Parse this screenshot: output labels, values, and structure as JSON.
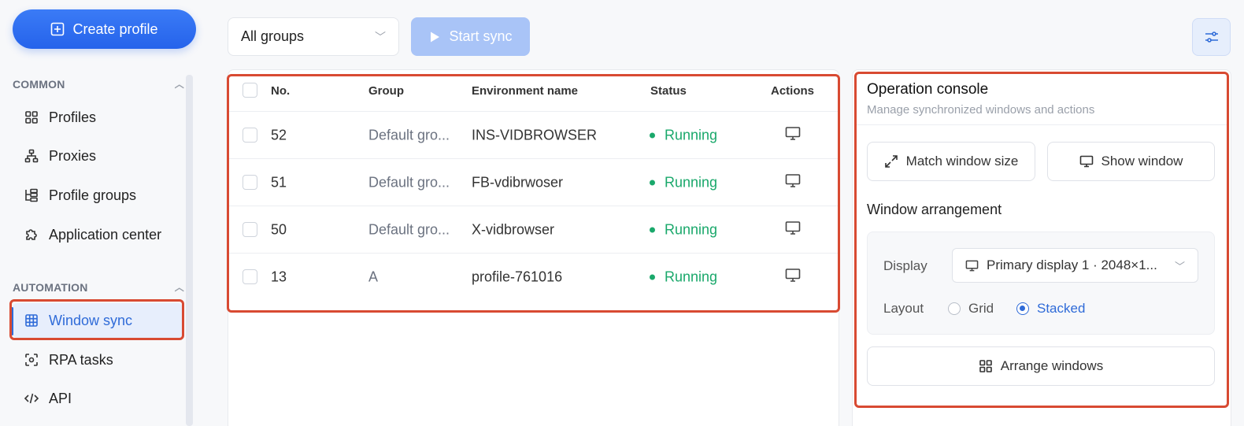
{
  "sidebar": {
    "create_label": "Create profile",
    "common_label": "COMMON",
    "automation_label": "AUTOMATION",
    "common_items": [
      {
        "label": "Profiles",
        "icon": "grid-icon"
      },
      {
        "label": "Proxies",
        "icon": "network-icon"
      },
      {
        "label": "Profile groups",
        "icon": "tree-icon"
      },
      {
        "label": "Application center",
        "icon": "puzzle-icon"
      }
    ],
    "automation_items": [
      {
        "label": "Window sync",
        "icon": "table-grid-icon",
        "active": true
      },
      {
        "label": "RPA tasks",
        "icon": "scan-icon"
      },
      {
        "label": "API",
        "icon": "code-icon"
      }
    ]
  },
  "toolbar": {
    "group_select": "All groups",
    "start_sync_label": "Start sync"
  },
  "table": {
    "headers": {
      "no": "No.",
      "group": "Group",
      "env": "Environment name",
      "status": "Status",
      "actions": "Actions"
    },
    "rows": [
      {
        "no": "52",
        "group": "Default gro...",
        "env": "INS-VIDBROWSER",
        "status": "Running"
      },
      {
        "no": "51",
        "group": "Default gro...",
        "env": "FB-vdibrwoser",
        "status": "Running"
      },
      {
        "no": "50",
        "group": "Default gro...",
        "env": "X-vidbrowser",
        "status": "Running"
      },
      {
        "no": "13",
        "group": "A",
        "env": "profile-761016",
        "status": "Running"
      }
    ]
  },
  "console": {
    "title": "Operation console",
    "subtitle": "Manage synchronized windows and actions",
    "match_label": "Match window size",
    "show_label": "Show window",
    "arrangement_title": "Window arrangement",
    "display_label": "Display",
    "display_value": "Primary display 1 · 2048×1...",
    "layout_label": "Layout",
    "layout_options": [
      "Grid",
      "Stacked"
    ],
    "layout_selected": "Stacked",
    "arrange_label": "Arrange windows"
  },
  "colors": {
    "accent": "#2f6bd8",
    "running": "#1aa86b",
    "highlight": "#d84a32"
  }
}
